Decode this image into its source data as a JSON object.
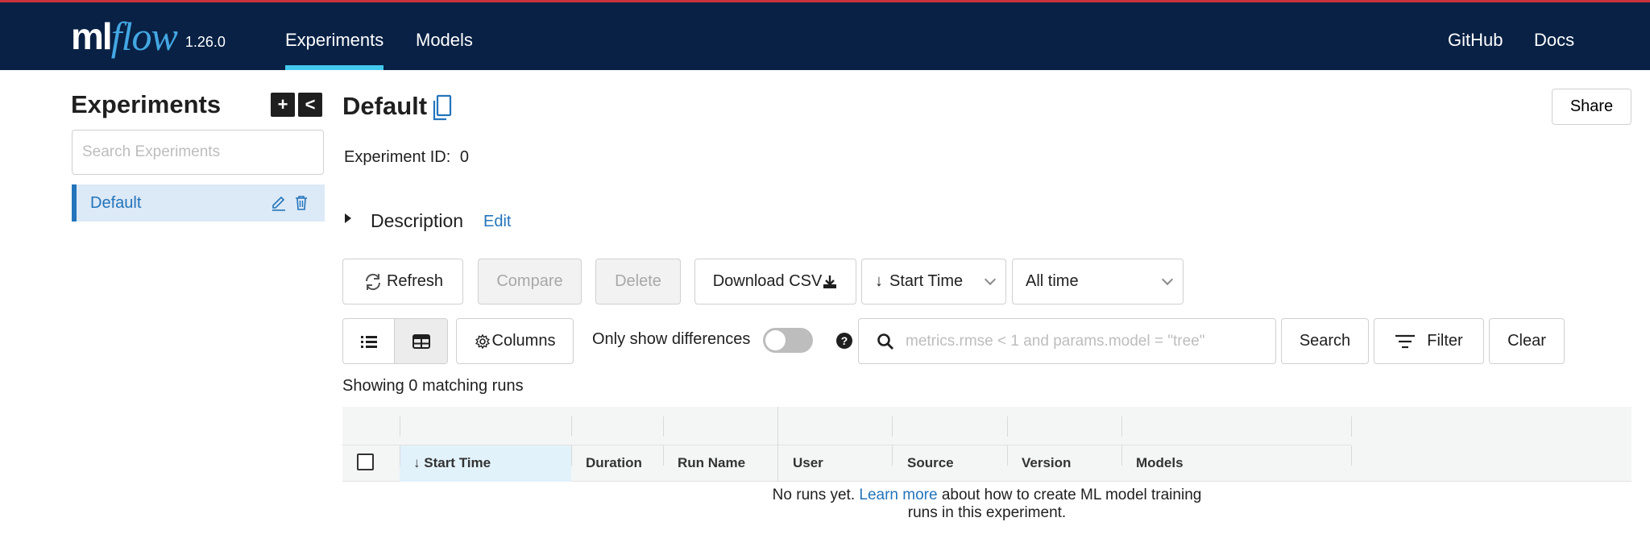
{
  "header": {
    "logo_ml": "ml",
    "logo_flow": "flow",
    "version": "1.26.0",
    "nav": {
      "experiments": "Experiments",
      "models": "Models",
      "github": "GitHub",
      "docs": "Docs"
    }
  },
  "sidebar": {
    "title": "Experiments",
    "add_symbol": "+",
    "collapse_symbol": "<",
    "search_placeholder": "Search Experiments",
    "items": [
      {
        "label": "Default"
      }
    ]
  },
  "main": {
    "title": "Default",
    "share_label": "Share",
    "experiment_id_label": "Experiment ID:",
    "experiment_id_value": "0",
    "description_label": "Description",
    "description_edit": "Edit",
    "toolbar": {
      "refresh": "Refresh",
      "compare": "Compare",
      "delete": "Delete",
      "download_csv": "Download CSV",
      "sort_selected": "Start Time",
      "time_range_selected": "All time",
      "columns": "Columns",
      "only_show_differences": "Only show differences",
      "help_symbol": "?",
      "search_placeholder": "metrics.rmse < 1 and params.model = \"tree\"",
      "search_button": "Search",
      "filter_button": "Filter",
      "clear_button": "Clear"
    },
    "runs_count_text": "Showing 0 matching runs",
    "table": {
      "columns": [
        "Start Time",
        "Duration",
        "Run Name",
        "User",
        "Source",
        "Version",
        "Models"
      ],
      "empty_prefix": "No runs yet.",
      "empty_link": "Learn more",
      "empty_suffix": "about how to create ML model training runs in this experiment."
    }
  },
  "colors": {
    "header_bg": "#082145",
    "accent_blue": "#2374bb",
    "logo_flow": "#43a7e3",
    "nav_active_underline": "#43c9ed"
  }
}
